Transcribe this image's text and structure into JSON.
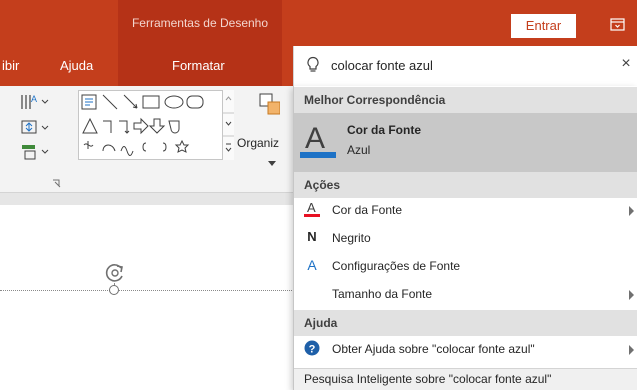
{
  "app": {
    "contextual_tab_title": "Ferramentas de Desenho",
    "signin_label": "Entrar"
  },
  "tabs": {
    "partial": "ibir",
    "help": "Ajuda",
    "format": "Formatar"
  },
  "ribbon": {
    "organize_label": "Organiz"
  },
  "search": {
    "value": "colocar fonte azul",
    "close_glyph": "×"
  },
  "results": {
    "best_match_header": "Melhor Correspondência",
    "best_match": {
      "title": "Cor da Fonte",
      "subtitle": "Azul"
    },
    "actions_header": "Ações",
    "actions": [
      {
        "label": "Cor da Fonte",
        "icon": "font-color-icon",
        "has_submenu": true
      },
      {
        "label": "Negrito",
        "icon": "bold-icon",
        "glyph": "N",
        "has_submenu": false
      },
      {
        "label": "Configurações de Fonte",
        "icon": "font-settings-icon",
        "glyph": "A",
        "has_submenu": false
      },
      {
        "label": "Tamanho da Fonte",
        "icon": "",
        "has_submenu": true
      }
    ],
    "help_header": "Ajuda",
    "help_item": {
      "label": "Obter Ajuda sobre \"colocar fonte azul\"",
      "icon": "help-icon",
      "glyph": "?"
    },
    "footer": "Pesquisa Inteligente sobre \"colocar fonte azul\""
  },
  "colors": {
    "brand": "#c43e1c",
    "contextual": "#b53217",
    "font_color_red": "#e81123",
    "font_blue": "#1e72c6"
  }
}
